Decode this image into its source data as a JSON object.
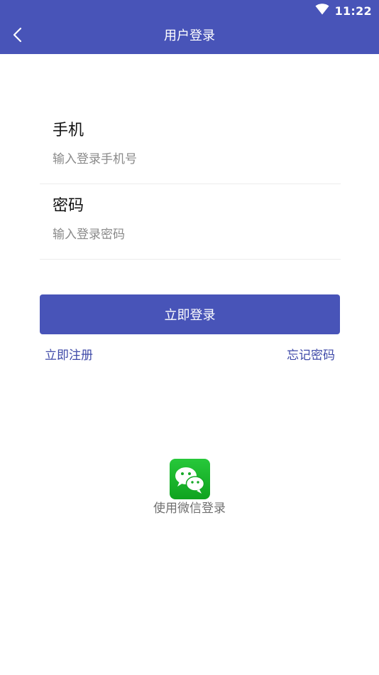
{
  "status_bar": {
    "time": "11:22"
  },
  "header": {
    "title": "用户登录"
  },
  "form": {
    "phone": {
      "label": "手机",
      "placeholder": "输入登录手机号"
    },
    "password": {
      "label": "密码",
      "placeholder": "输入登录密码"
    }
  },
  "actions": {
    "login_label": "立即登录",
    "register_label": "立即注册",
    "forgot_label": "忘记密码"
  },
  "wechat": {
    "label": "使用微信登录"
  },
  "colors": {
    "primary": "#4854b8",
    "link": "#3f4aa8",
    "wechat": "#1ab82a"
  },
  "icons": [
    "wifi-icon",
    "back-arrow-icon",
    "wechat-icon"
  ]
}
